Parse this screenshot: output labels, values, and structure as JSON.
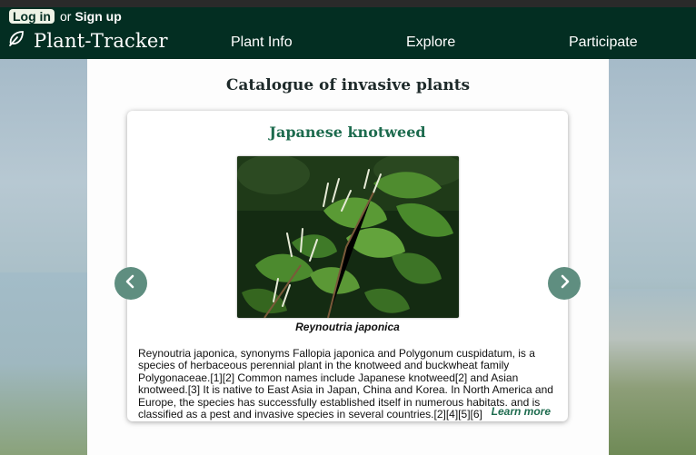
{
  "header": {
    "login_label": "Log in",
    "or_text": "or",
    "signup_label": "Sign up",
    "brand": "Plant-Tracker",
    "brand_icon": "leaf-icon",
    "nav": [
      {
        "label": "Plant Info"
      },
      {
        "label": "Explore"
      },
      {
        "label": "Participate"
      }
    ],
    "bg_color": "#032e22"
  },
  "main": {
    "title": "Catalogue of invasive plants",
    "card": {
      "plant_name": "Japanese knotweed",
      "image_caption": "Reynoutria japonica",
      "description": "Reynoutria japonica, synonyms Fallopia japonica and Polygonum cuspidatum, is a species of herbaceous perennial plant in the knotweed and buckwheat family Polygonaceae.[1][2] Common names include Japanese knotweed[2] and Asian knotweed.[3] It is native to East Asia in Japan, China and Korea. In North America and Europe, the species has successfully established itself in numerous habitats, and is classified as a pest and invasive species in several countries.[2][4][5][6]",
      "learn_more": "Learn more",
      "accent_color": "#1d6b4e"
    },
    "prev_icon": "chevron-left-icon",
    "next_icon": "chevron-right-icon"
  }
}
